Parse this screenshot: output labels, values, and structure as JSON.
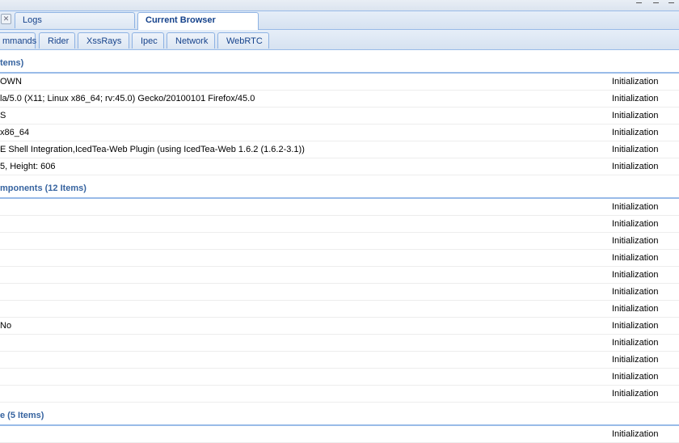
{
  "tabs": [
    {
      "label": "Logs",
      "active": false
    },
    {
      "label": "Current Browser",
      "active": true
    }
  ],
  "subtabs": [
    {
      "label": "mmands"
    },
    {
      "label": "Rider"
    },
    {
      "label": "XssRays"
    },
    {
      "label": "Ipec"
    },
    {
      "label": "Network"
    },
    {
      "label": "WebRTC"
    }
  ],
  "groups": [
    {
      "title": "tems)",
      "rows": [
        {
          "value": "OWN",
          "source": "Initialization"
        },
        {
          "value": "la/5.0 (X11; Linux x86_64; rv:45.0) Gecko/20100101 Firefox/45.0",
          "source": "Initialization"
        },
        {
          "value": "S",
          "source": "Initialization"
        },
        {
          "value": "x86_64",
          "source": "Initialization"
        },
        {
          "value": "E Shell Integration,IcedTea-Web Plugin (using IcedTea-Web 1.6.2 (1.6.2-3.1))",
          "source": "Initialization"
        },
        {
          "value": "5, Height: 606",
          "source": "Initialization"
        }
      ]
    },
    {
      "title": "mponents (12 Items)",
      "rows": [
        {
          "value": "",
          "source": "Initialization"
        },
        {
          "value": "",
          "source": "Initialization"
        },
        {
          "value": "",
          "source": "Initialization"
        },
        {
          "value": "",
          "source": "Initialization"
        },
        {
          "value": "",
          "source": "Initialization"
        },
        {
          "value": "",
          "source": "Initialization"
        },
        {
          "value": "",
          "source": "Initialization"
        },
        {
          "value": "No",
          "source": "Initialization"
        },
        {
          "value": "",
          "source": "Initialization"
        },
        {
          "value": "",
          "source": "Initialization"
        },
        {
          "value": "",
          "source": "Initialization"
        },
        {
          "value": "",
          "source": "Initialization"
        }
      ]
    },
    {
      "title": "e (5 Items)",
      "rows": [
        {
          "value": "",
          "source": "Initialization"
        }
      ]
    }
  ]
}
